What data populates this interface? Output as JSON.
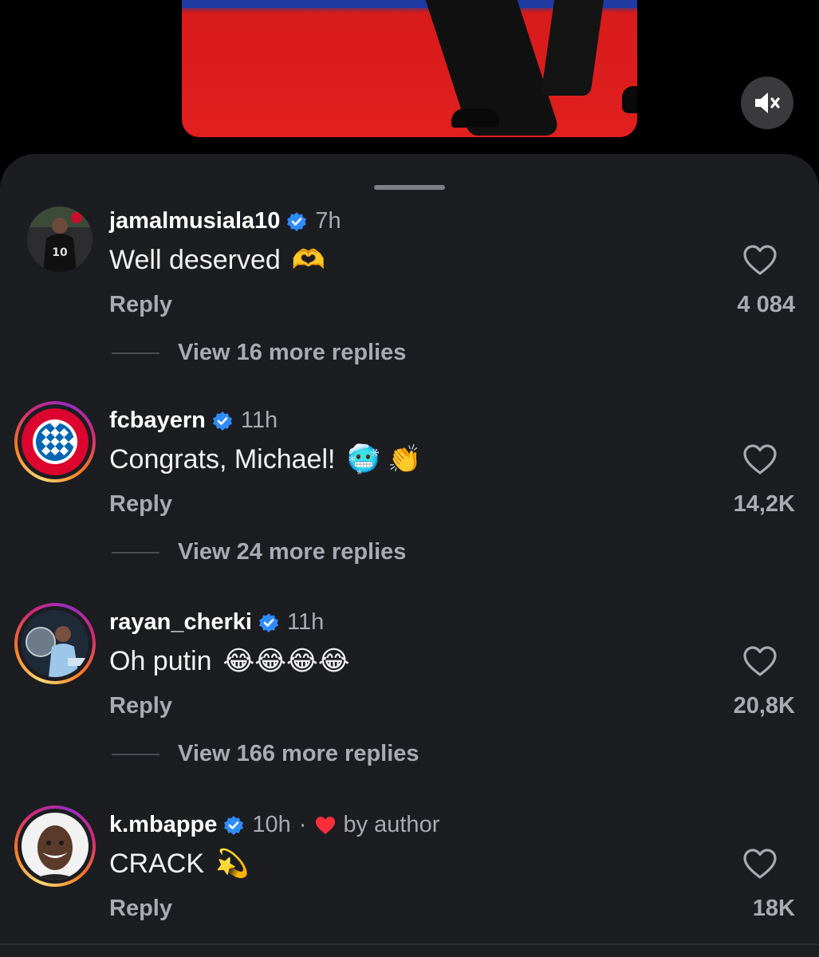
{
  "player": {
    "mute_icon": "speaker-muted-icon"
  },
  "colors": {
    "sheet_bg": "#1c1d21",
    "secondary_text": "#a8abb2",
    "verified_blue": "#2f8cff",
    "heart_red": "#ff2d3c"
  },
  "comments": [
    {
      "username": "jamalmusiala10",
      "time": "7h",
      "text": "Well deserved",
      "emoji": "🫶",
      "reply_label": "Reply",
      "likes": "4 084",
      "view_more": "View 16 more replies"
    },
    {
      "username": "fcbayern",
      "time": "11h",
      "text": "Congrats, Michael!",
      "emoji": "🥶 👏",
      "reply_label": "Reply",
      "likes": "14,2K",
      "view_more": "View 24 more replies"
    },
    {
      "username": "rayan_cherki",
      "time": "11h",
      "text": "Oh putin",
      "emoji": "😂😂😂😂",
      "reply_label": "Reply",
      "likes": "20,8K",
      "view_more": "View 166 more replies"
    },
    {
      "username": "k.mbappe",
      "time": "10h",
      "separator": "·",
      "liked_by": "by author",
      "text": "CRACK",
      "emoji": "💫",
      "reply_label": "Reply",
      "likes": "18K"
    }
  ]
}
